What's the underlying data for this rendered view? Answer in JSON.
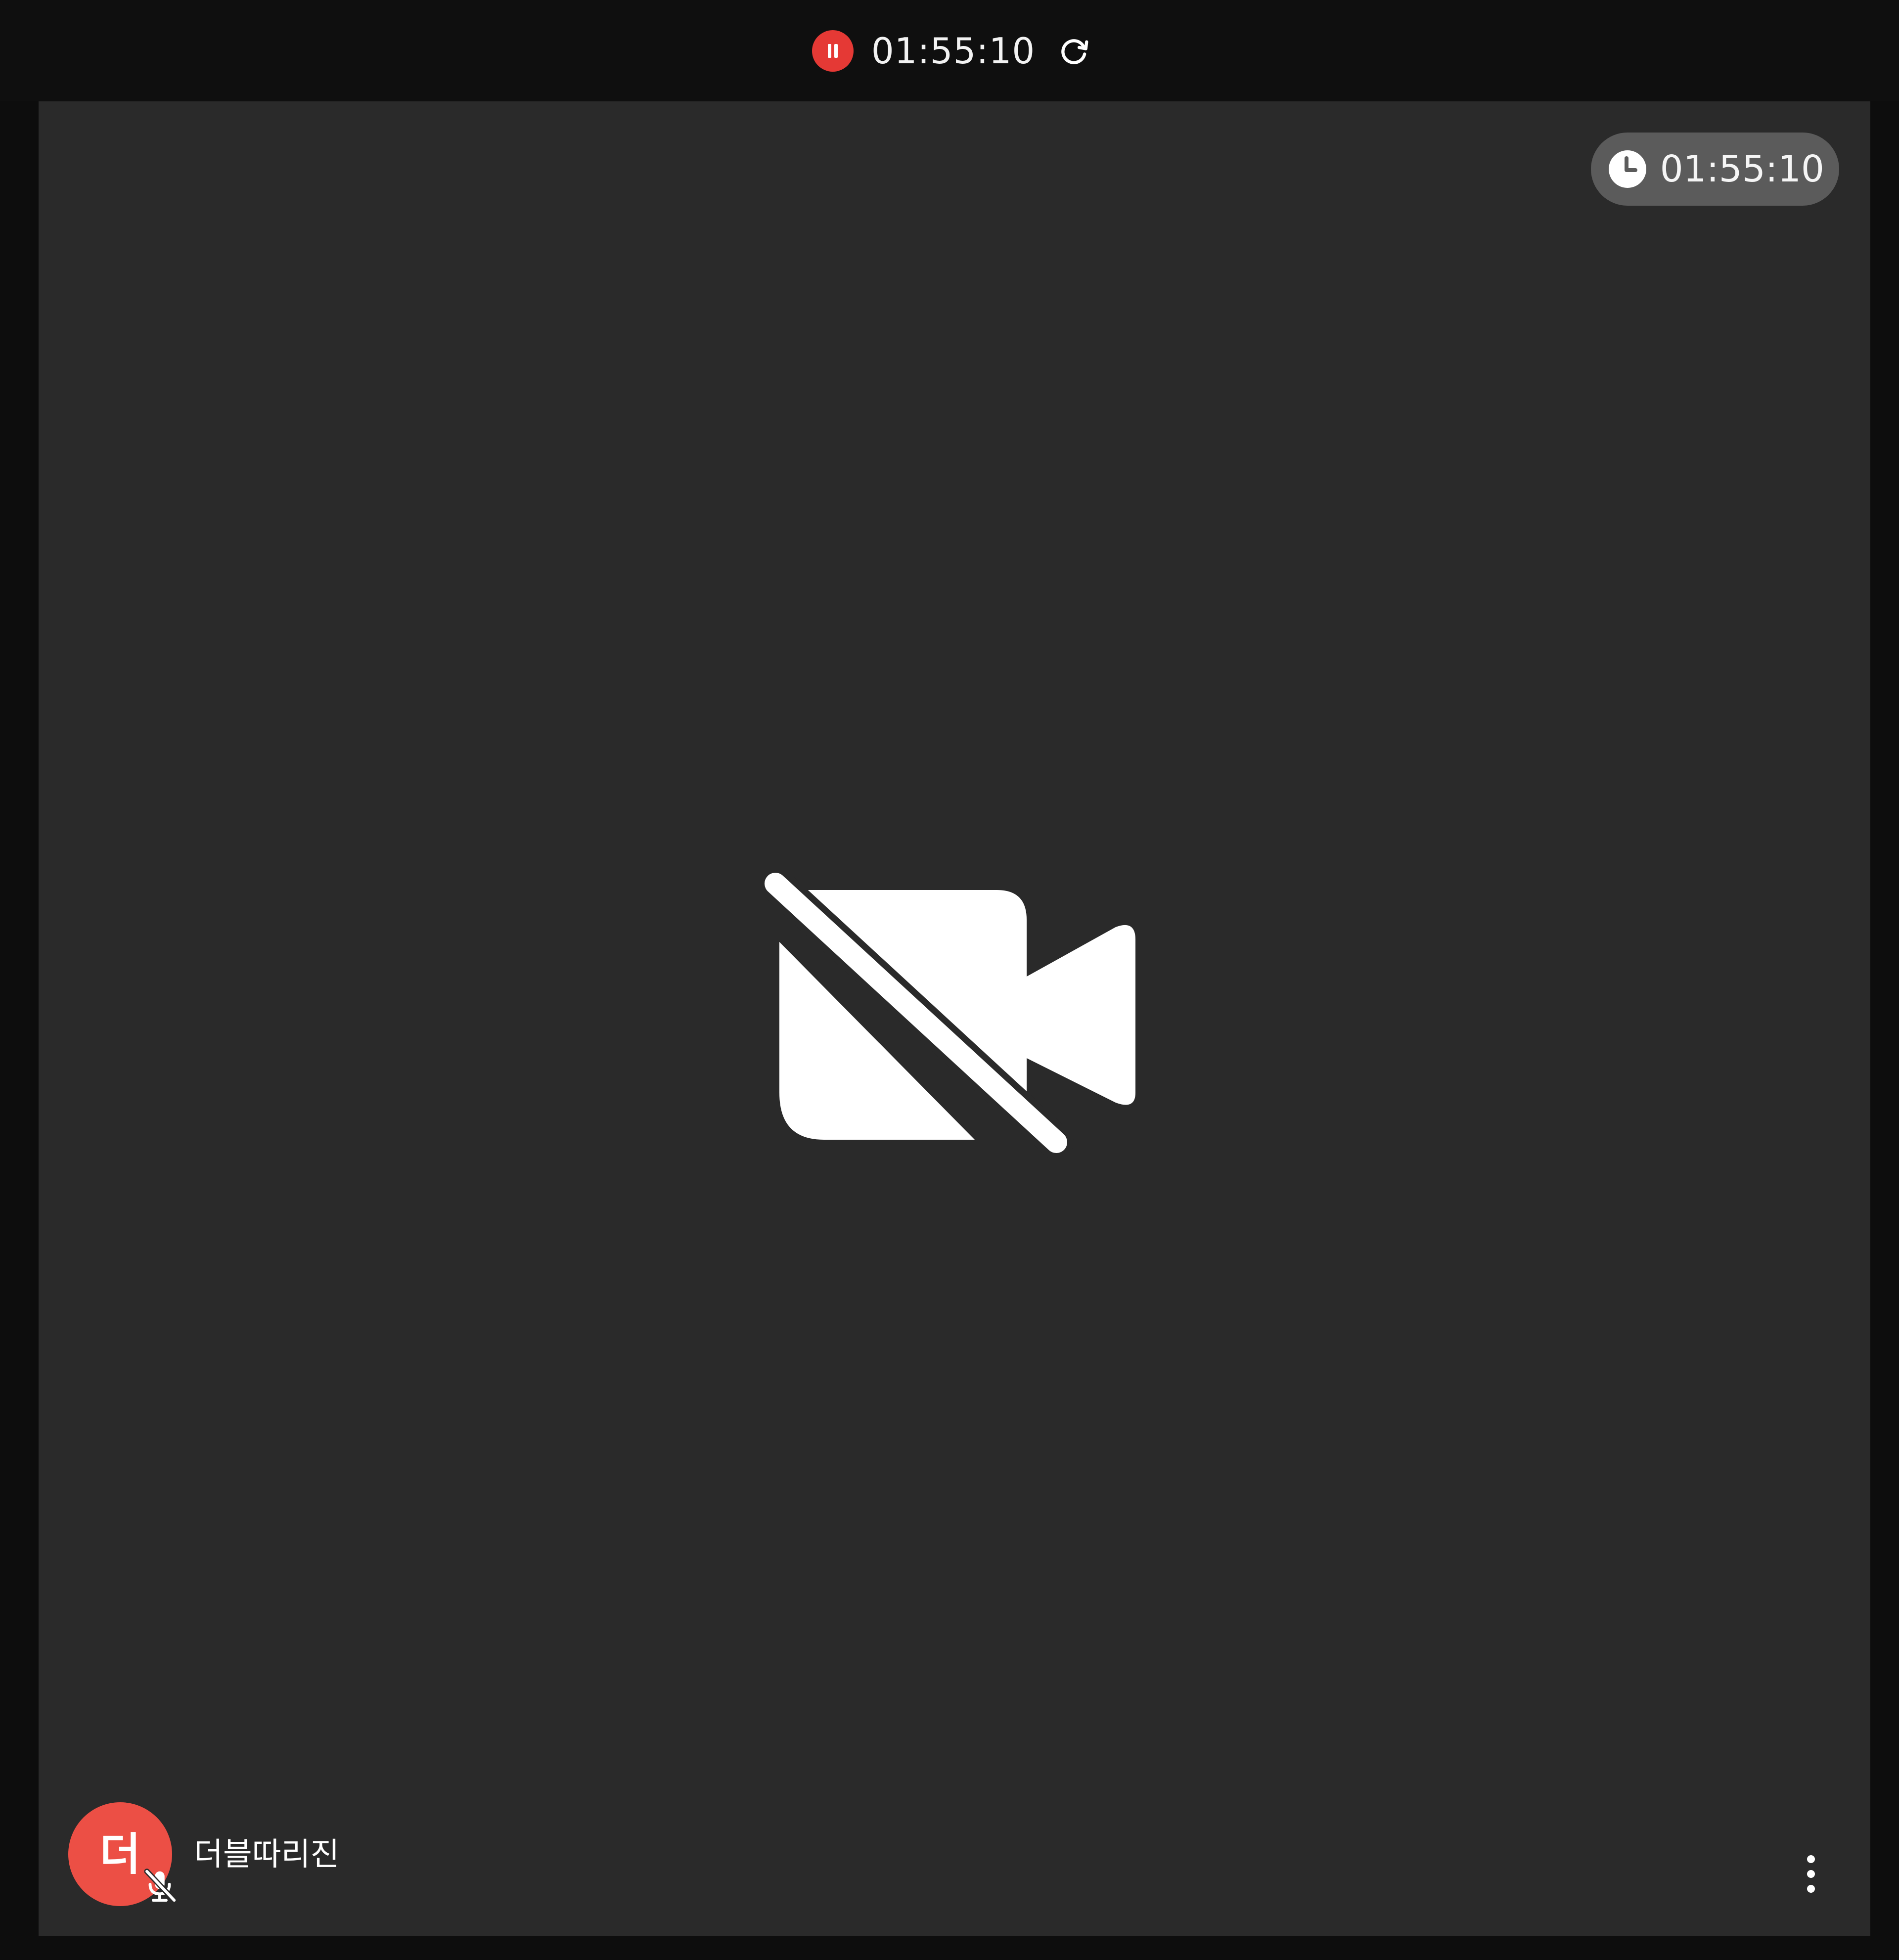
{
  "recording_bar": {
    "status_icon": "pause-circle-icon",
    "elapsed": "01:55:10",
    "refresh_icon": "refresh-icon",
    "status_color": "#e53935"
  },
  "video_tile": {
    "timer": {
      "icon": "clock-icon",
      "value": "01:55:10"
    },
    "center_icon": "camera-off-icon",
    "participant": {
      "initial": "더",
      "name": "더블따리진",
      "avatar_color": "#ec4f45",
      "mic_icon": "mic-off-icon"
    },
    "more_icon": "more-vertical-icon"
  }
}
